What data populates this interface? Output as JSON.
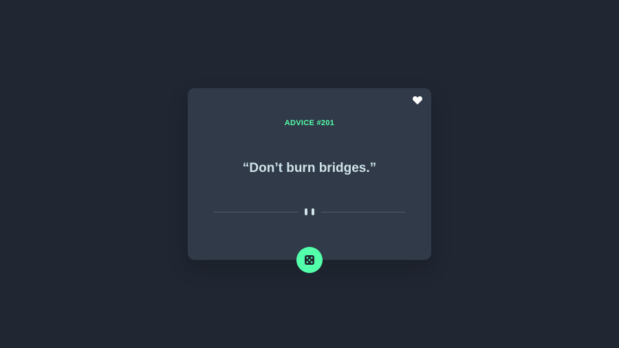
{
  "card": {
    "advice_label": "ADVICE #201",
    "advice_text": "“Don’t burn bridges.”"
  },
  "icons": {
    "favorite": "heart-icon",
    "divider": "pause-icon",
    "generate": "dice-icon"
  },
  "colors": {
    "background": "#202632",
    "card": "#313a48",
    "accent": "#53ffaa",
    "text": "#cee3e9",
    "divider": "#4f5d74"
  }
}
